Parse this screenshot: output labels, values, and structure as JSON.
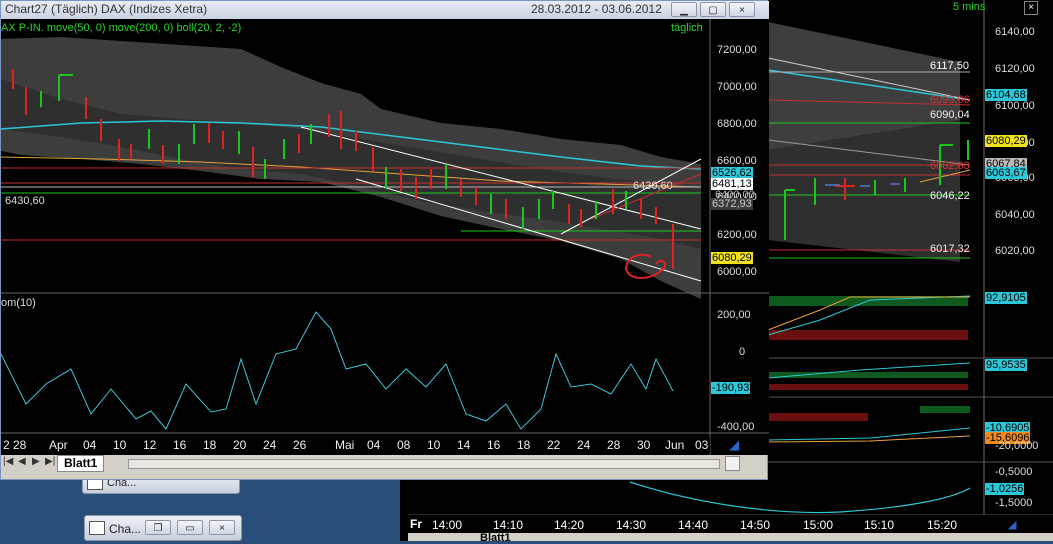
{
  "front": {
    "title": "Chart27 (Täglich)  DAX (Indizes Xetra)",
    "date_range": "28.03.2012 - 03.06.2012",
    "indicator_line": "AX P-IN. move(50, 0) move(200, 0) boll(20, 2, -2)",
    "period_label": "täglich",
    "sheet_tab": "Blatt1",
    "mom_label": "om(10)",
    "price_axis": [
      "7200,00",
      "7000,00",
      "6800,00",
      "6600,00",
      "6400,00",
      "6200,00",
      "6000,00"
    ],
    "price_tags": [
      "6526,62",
      "6481,13",
      "6372,93",
      "6080,29"
    ],
    "price_tag_overlap": "6400,00",
    "level_left": "6430,60",
    "level_inner": "6430,60",
    "mom_axis": [
      "200,00",
      "0",
      "-200,00",
      "-400,00"
    ],
    "mom_tag": "-190,93",
    "date_axis": [
      "2 28",
      "Apr",
      "04",
      "10",
      "12",
      "16",
      "18",
      "20",
      "24",
      "26",
      "Mai",
      "04",
      "08",
      "10",
      "14",
      "16",
      "18",
      "22",
      "24",
      "28",
      "30",
      "Jun",
      "03"
    ],
    "colors": {
      "up": "#19c81c",
      "down": "#e02222",
      "boll": "#4a4a4a",
      "ma": "#2ac8d8",
      "mom": "#3fc6d6"
    }
  },
  "back": {
    "timeframe": "5 mins",
    "price_axis": [
      "6140,00",
      "6120,00",
      "6100,00",
      "6080,00",
      "6060,00",
      "6040,00",
      "6020,00"
    ],
    "levels": [
      "6117,50",
      "6099,06",
      "6090,04",
      "6062,63",
      "6046,22",
      "6017,32"
    ],
    "price_tags": [
      "6104,68",
      "6080,29",
      "6067,84",
      "6063,67"
    ],
    "osc1_tag": "92,9105",
    "osc2_tag": "95,9535",
    "osc3_axis": [
      "-10,0000",
      "-20,0000"
    ],
    "osc3_tags": [
      "-10,6905",
      "-15,6096"
    ],
    "osc4_axis": [
      "-0,5000",
      "-1,5000"
    ],
    "osc4_tag": "-1,0256",
    "time_axis": [
      "Fr",
      "14:00",
      "14:10",
      "14:20",
      "14:30",
      "14:40",
      "14:50",
      "15:00",
      "15:10",
      "15:20"
    ],
    "sheet_tab": "Blatt1"
  },
  "taskbar": {
    "items": [
      "Cha...",
      "Cha..."
    ]
  }
}
